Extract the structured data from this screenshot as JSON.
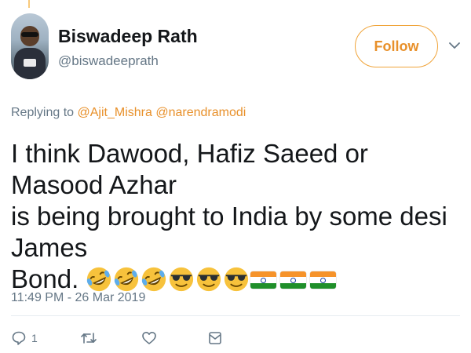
{
  "author": {
    "name": "Biswadeep Rath",
    "handle": "@biswadeeprath"
  },
  "follow_button": {
    "label": "Follow"
  },
  "reply_context": {
    "prefix": "Replying to",
    "mention_1": "@Ajit_Mishra",
    "mention_2": "@narendramodi"
  },
  "tweet": {
    "line_1": "I think Dawood, Hafiz Saeed or Masood Azhar",
    "line_2": "is being brought to India by some desi James",
    "line_3": "Bond.",
    "emojis": [
      "rolling-laughing",
      "rolling-laughing",
      "rolling-laughing",
      "sunglasses-face",
      "sunglasses-face",
      "sunglasses-face",
      "india-flag",
      "india-flag",
      "india-flag"
    ]
  },
  "timestamp": "11:49 PM - 26 Mar 2019",
  "actions": {
    "reply_count": "1",
    "reply_icon": "reply-icon",
    "retweet_icon": "retweet-icon",
    "like_icon": "heart-icon",
    "dm_icon": "message-icon"
  },
  "colors": {
    "accent": "#e8902a",
    "muted": "#657786",
    "text": "#14171a",
    "emoji_yellow": "#f7c23c"
  }
}
